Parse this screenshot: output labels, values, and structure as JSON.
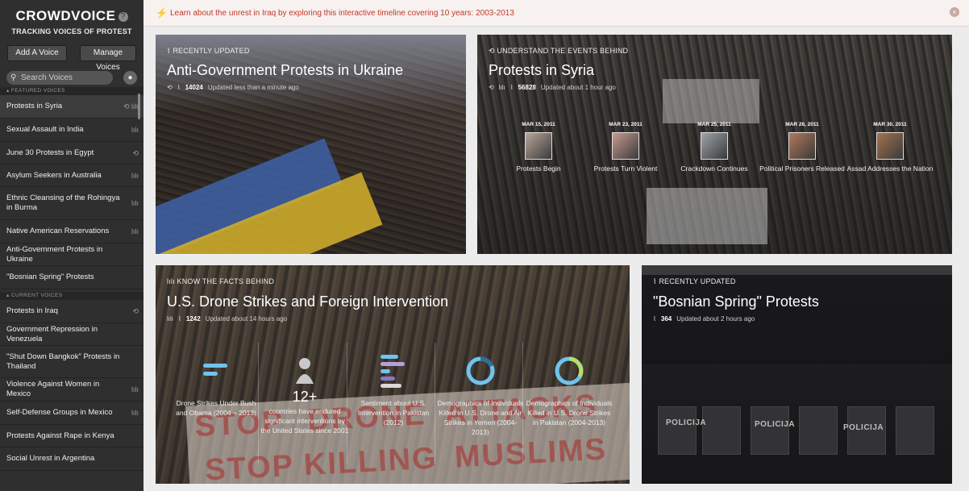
{
  "sidebar": {
    "logo": "CROWDVOICE",
    "help": "?",
    "tagline": "TRACKING VOICES OF PROTEST",
    "add_voice": "Add A Voice",
    "manage_voices": "Manage Voices",
    "search_placeholder": "Search Voices",
    "featured_heading": "FEATURED VOICES",
    "featured": [
      {
        "label": "Protests in Syria",
        "icons": "⟲ lılı"
      },
      {
        "label": "Sexual Assault in India",
        "icons": "lılı"
      },
      {
        "label": "June 30 Protests in Egypt",
        "icons": "⟲"
      },
      {
        "label": "Asylum Seekers in Australia",
        "icons": "lılı"
      },
      {
        "label": "Ethnic Cleansing of the Rohingya in Burma",
        "icons": "lılı"
      },
      {
        "label": "Native American Reservations",
        "icons": "lılı"
      },
      {
        "label": "Anti-Government Protests in Ukraine",
        "icons": ""
      },
      {
        "label": "\"Bosnian Spring\" Protests",
        "icons": ""
      }
    ],
    "current_heading": "CURRENT VOICES",
    "current": [
      {
        "label": "Protests in Iraq",
        "icons": "⟲"
      },
      {
        "label": "Government Repression in Venezuela",
        "icons": ""
      },
      {
        "label": "\"Shut Down Bangkok\" Protests in Thailand",
        "icons": ""
      },
      {
        "label": "Violence Against Women in Mexico",
        "icons": "lılı"
      },
      {
        "label": "Self-Defense Groups in Mexico",
        "icons": "lılı"
      },
      {
        "label": "Protests Against Rape in Kenya",
        "icons": ""
      },
      {
        "label": "Social Unrest in Argentina",
        "icons": ""
      }
    ]
  },
  "notice": {
    "text": "Learn about the unrest in Iraq by exploring this interactive timeline covering 10 years: 2003-2013",
    "close": "×"
  },
  "cards": {
    "ukraine": {
      "label": "RECENTLY UPDATED",
      "title": "Anti-Government Protests in Ukraine",
      "count": "14024",
      "updated": "Updated less than a minute ago"
    },
    "syria": {
      "label": "UNDERSTAND THE EVENTS BEHIND",
      "title": "Protests in Syria",
      "count": "56828",
      "updated": "Updated about 1 hour ago",
      "timeline": [
        {
          "date": "MAR 15, 2011",
          "caption": "Protests Begin"
        },
        {
          "date": "MAR 23, 2011",
          "caption": "Protests Turn Violent"
        },
        {
          "date": "MAR 25, 2011",
          "caption": "Crackdown Continues"
        },
        {
          "date": "MAR 26, 2011",
          "caption": "Political Prisoners Released"
        },
        {
          "date": "MAR 30, 2011",
          "caption": "Assad Addresses the Nation"
        }
      ]
    },
    "drones": {
      "label": "KNOW THE FACTS BEHIND",
      "title": "U.S. Drone Strikes and Foreign Intervention",
      "count": "1242",
      "updated": "Updated about 14 hours ago",
      "banner_words": [
        "STOP",
        "DRONE",
        "ATTACKS",
        "STOP KILLING",
        "MUSLIMS"
      ],
      "facts": [
        {
          "big": "",
          "text": "Drone Strikes Under Bush and Obama (2004 – 2013)"
        },
        {
          "big": "12+",
          "text": "countries have endured significant interventions by the United States since 2001"
        },
        {
          "big": "",
          "text": "Sentiment about U.S. Intervention in Pakistan (2012)"
        },
        {
          "big": "",
          "text": "Demographics of Individuals Killed in U.S. Drone and Air Strikes in Yemen (2004-2013)"
        },
        {
          "big": "",
          "text": "Demographics of Individuals Killed in U.S. Drone Strikes in Pakistan (2004-2013)"
        }
      ]
    },
    "bosnia": {
      "label": "RECENTLY UPDATED",
      "title": "\"Bosnian Spring\" Protests",
      "count": "364",
      "updated": "Updated about 2 hours ago",
      "policija": "POLICIJA"
    }
  }
}
